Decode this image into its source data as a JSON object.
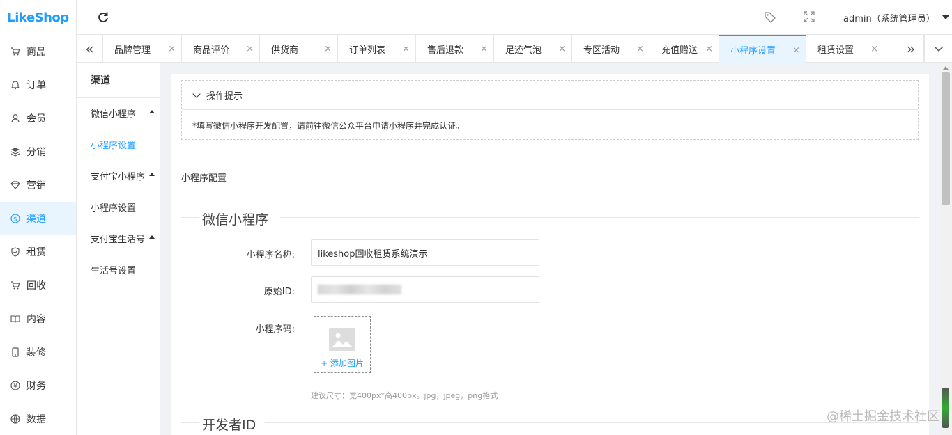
{
  "app": {
    "logo": "LikeShop"
  },
  "sidebar": {
    "items": [
      {
        "label": "商品",
        "icon": "cart-icon"
      },
      {
        "label": "订单",
        "icon": "bell-icon"
      },
      {
        "label": "会员",
        "icon": "user-icon"
      },
      {
        "label": "分销",
        "icon": "layers-icon"
      },
      {
        "label": "营销",
        "icon": "diamond-icon"
      },
      {
        "label": "渠道",
        "icon": "dollar-circle-icon",
        "active": true
      },
      {
        "label": "租赁",
        "icon": "shield-icon"
      },
      {
        "label": "回收",
        "icon": "cart-icon"
      },
      {
        "label": "内容",
        "icon": "book-icon"
      },
      {
        "label": "装修",
        "icon": "tablet-icon"
      },
      {
        "label": "财务",
        "icon": "yen-circle-icon"
      },
      {
        "label": "数据",
        "icon": "globe-icon"
      }
    ]
  },
  "header": {
    "user": "admin（系统管理员）"
  },
  "tabs": [
    {
      "label": "品牌管理"
    },
    {
      "label": "商品评价"
    },
    {
      "label": "供货商"
    },
    {
      "label": "订单列表"
    },
    {
      "label": "售后退款"
    },
    {
      "label": "足迹气泡"
    },
    {
      "label": "专区活动"
    },
    {
      "label": "充值赠送"
    },
    {
      "label": "小程序设置",
      "active": true
    },
    {
      "label": "租赁设置"
    }
  ],
  "subnav": {
    "title": "渠道",
    "items": [
      {
        "label": "微信小程序",
        "group": true
      },
      {
        "label": "小程序设置",
        "active": true
      },
      {
        "label": "支付宝小程序",
        "group": true
      },
      {
        "label": "小程序设置"
      },
      {
        "label": "支付宝生活号",
        "group": true
      },
      {
        "label": "生活号设置"
      }
    ]
  },
  "tip": {
    "title": "操作提示",
    "body": "*填写微信小程序开发配置，请前往微信公众平台申请小程序并完成认证。"
  },
  "section": {
    "title": "小程序配置"
  },
  "form": {
    "fieldset_title": "微信小程序",
    "name_label": "小程序名称:",
    "name_value": "likeshop回收租赁系统演示",
    "id_label": "原始ID:",
    "code_label": "小程序码:",
    "upload_label": "+ 添加图片",
    "hint": "建议尺寸：宽400px*高400px。jpg，jpeg，png格式",
    "fieldset2_title": "开发者ID"
  },
  "watermark": "@稀土掘金技术社区",
  "colors": {
    "accent": "#1e9fff",
    "active_bg": "#e8f4fe"
  }
}
